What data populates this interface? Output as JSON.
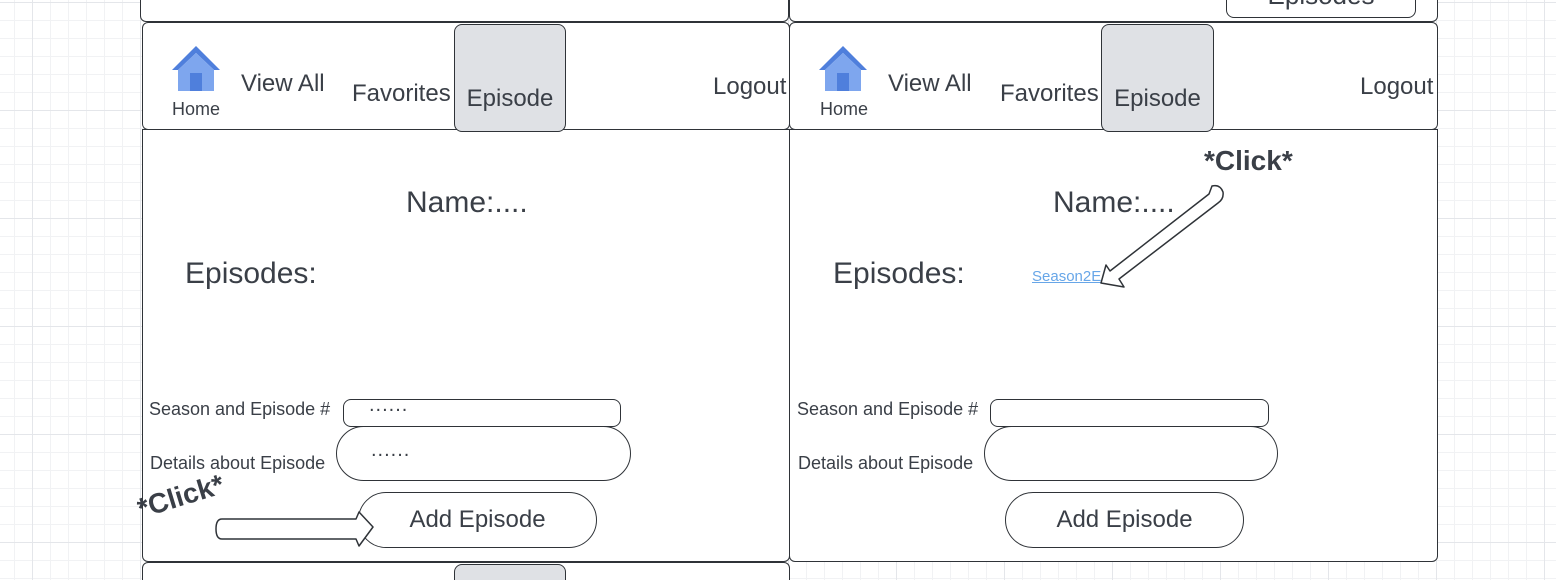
{
  "nav": {
    "home_label": "Home",
    "view_all": "View All",
    "favorites": "Favorites",
    "episode_tab": "Episode",
    "logout": "Logout"
  },
  "top_partial": {
    "button_label": "Episodes"
  },
  "left_panel": {
    "name_label": "Name:....",
    "episodes_label": "Episodes:",
    "season_label": "Season and Episode #",
    "season_value": "......",
    "details_label": "Details about Episode",
    "details_value": "......",
    "add_button": "Add Episode",
    "click_note": "*Click*"
  },
  "right_panel": {
    "name_label": "Name:....",
    "episodes_label": "Episodes:",
    "episode_link": "Season2E",
    "season_label": "Season and Episode #",
    "season_value": "",
    "details_label": "Details about Episode",
    "details_value": "",
    "add_button": "Add Episode",
    "click_note": "*Click*"
  },
  "colors": {
    "active_tab": "#dfe1e5",
    "link": "#67a6e8",
    "home_icon_light": "#7ea6ee",
    "home_icon_dark": "#4f7fdc",
    "border": "#2f3338"
  }
}
